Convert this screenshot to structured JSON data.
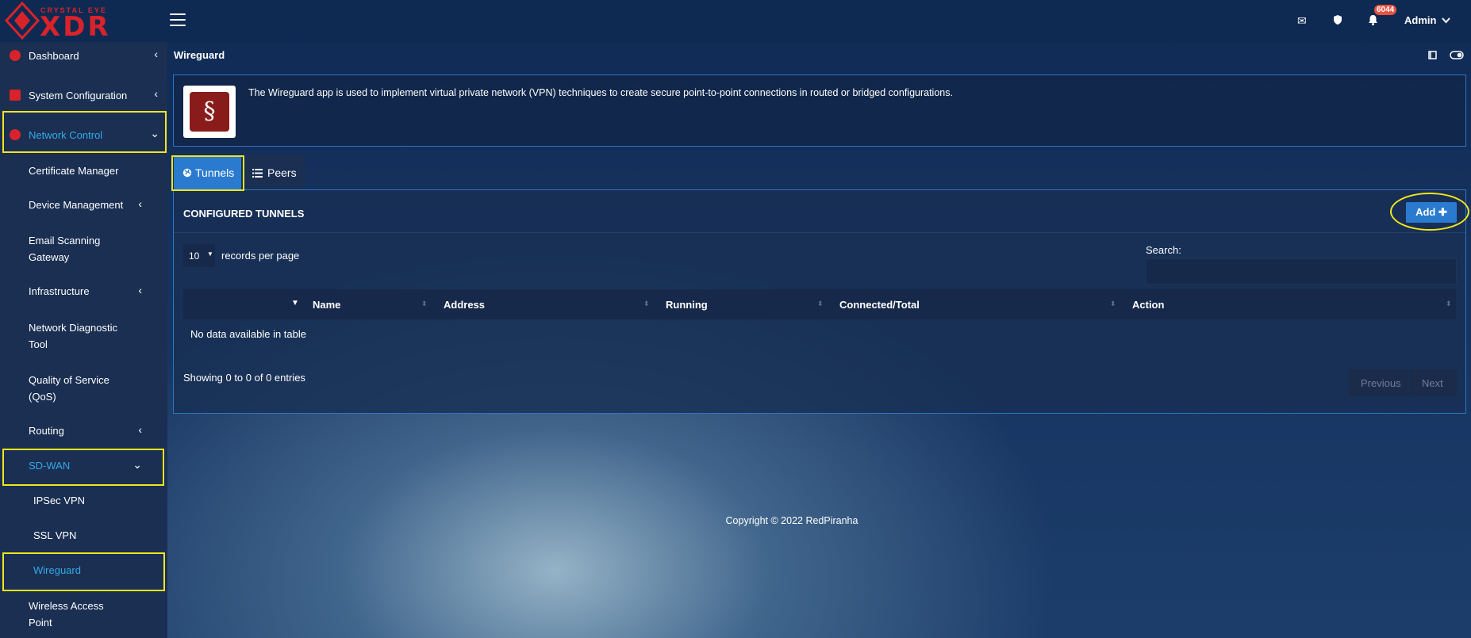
{
  "brand": {
    "line1": "CRYSTAL EYE",
    "line2": "XDR",
    "color": "#d8232a"
  },
  "topbar": {
    "notification_count": "6044",
    "user": "Admin",
    "icons": [
      "envelope-icon",
      "shield-icon",
      "bell-icon"
    ]
  },
  "sidebar": {
    "items": [
      {
        "label": "Dashboard",
        "icon": "gauge-icon",
        "chevron": "‹"
      },
      {
        "label": "System Configuration",
        "icon": "home-icon",
        "chevron": "‹"
      },
      {
        "label": "Network Control",
        "icon": "network-icon",
        "chevron": "⌄",
        "active": true
      },
      {
        "label": "Certificate Manager"
      },
      {
        "label": "Device Management",
        "chevron": "‹"
      },
      {
        "label": "Email Scanning Gateway",
        "line1": "Email Scanning",
        "line2": "Gateway"
      },
      {
        "label": "Infrastructure",
        "chevron": "‹"
      },
      {
        "label": "Network Diagnostic Tool",
        "line1": "Network Diagnostic",
        "line2": "Tool"
      },
      {
        "label": "Quality of Service (QoS)",
        "line1": "Quality of Service",
        "line2": "(QoS)"
      },
      {
        "label": "Routing",
        "chevron": "‹"
      },
      {
        "label": "SD-WAN",
        "chevron": "⌄",
        "active": true
      },
      {
        "label": "IPSec VPN"
      },
      {
        "label": "SSL VPN"
      },
      {
        "label": "Wireguard",
        "active": true
      },
      {
        "label": "Wireless Access Point",
        "line1": "Wireless Access",
        "line2": "Point"
      }
    ]
  },
  "page": {
    "title": "Wireguard",
    "description": "The Wireguard app is used to implement virtual private network (VPN) techniques to create secure point-to-point connections in routed or bridged configurations."
  },
  "tabs": [
    {
      "label": "Tunnels",
      "icon": "globe-icon",
      "active": true
    },
    {
      "label": "Peers",
      "icon": "list-icon"
    }
  ],
  "panel": {
    "heading": "CONFIGURED TUNNELS",
    "add_label": "Add",
    "length_value": "10",
    "length_label": "records per page",
    "search_label": "Search:",
    "search_value": "",
    "columns": [
      "Name",
      "Address",
      "Running",
      "Connected/Total",
      "Action"
    ],
    "empty_text": "No data available in table",
    "info_text": "Showing 0 to 0 of 0 entries",
    "prev_label": "Previous",
    "next_label": "Next"
  },
  "footer": {
    "copyright": "Copyright © 2022 RedPiranha"
  },
  "colors": {
    "accent": "#2a7bd0",
    "active_text": "#35a9e8",
    "highlight": "#f2e61b",
    "sidebar_bg": "#1a2f52"
  }
}
